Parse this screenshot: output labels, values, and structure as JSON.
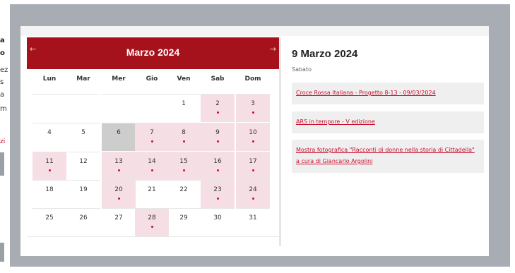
{
  "left_fragments": [
    "a",
    "o",
    "ez",
    "s",
    "a",
    "m",
    "zi"
  ],
  "calendar": {
    "month_title": "Marzo 2024",
    "prev_icon": "←",
    "next_icon": "→",
    "weekdays": [
      "Lun",
      "Mar",
      "Mer",
      "Gio",
      "Ven",
      "Sab",
      "Dom"
    ],
    "weeks": [
      [
        "",
        "",
        "",
        "",
        "1",
        "2",
        "3"
      ],
      [
        "4",
        "5",
        "6",
        "7",
        "8",
        "9",
        "10"
      ],
      [
        "11",
        "12",
        "13",
        "14",
        "15",
        "16",
        "17"
      ],
      [
        "18",
        "19",
        "20",
        "21",
        "22",
        "23",
        "24"
      ],
      [
        "25",
        "26",
        "27",
        "28",
        "29",
        "30",
        "31"
      ]
    ],
    "event_days": [
      2,
      3,
      7,
      8,
      9,
      10,
      11,
      13,
      14,
      15,
      16,
      17,
      20,
      23,
      24,
      28
    ],
    "selected_day": 6,
    "colors": {
      "header": "#a6121c",
      "event_bg": "#f6dfe4",
      "dot": "#c8102e",
      "selected_bg": "#cdcdcd"
    }
  },
  "detail": {
    "date_title": "9 Marzo 2024",
    "weekday": "Sabato",
    "events": [
      "Croce Rossa Italiana - Progetto 8-13 - 09/03/2024",
      "ARS in tempore - V edizione",
      "Mostra fotografica \"Racconti di donne nella storia di Cittadella\" a cura di Giancarlo Argolini"
    ]
  }
}
